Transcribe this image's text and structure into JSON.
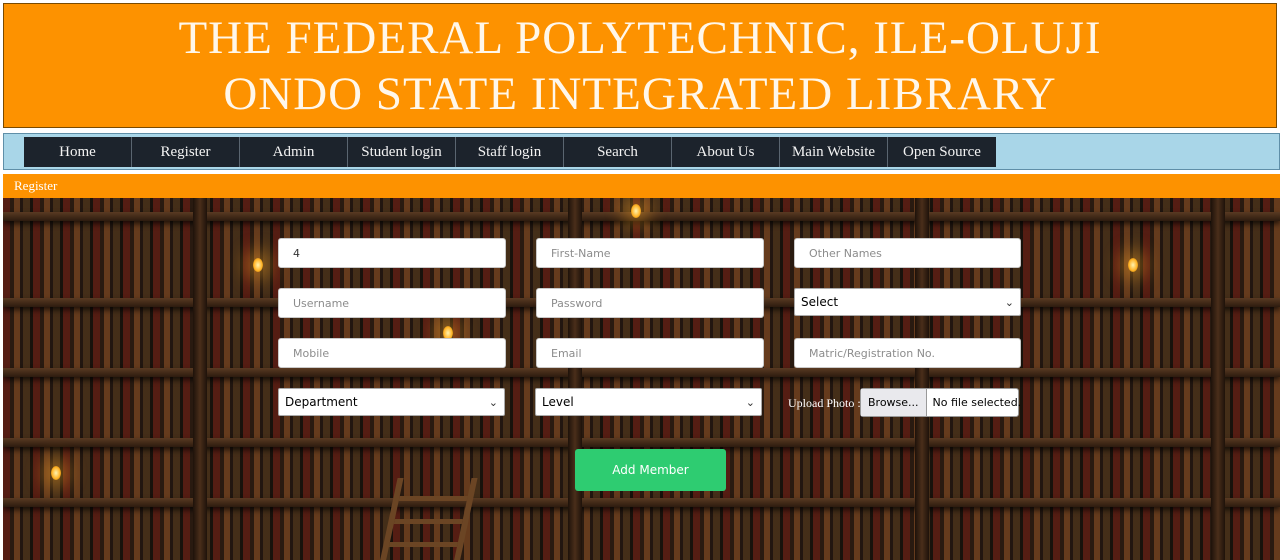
{
  "header": {
    "line1": "THE FEDERAL POLYTECHNIC, ILE-OLUJI",
    "line2": "ONDO STATE INTEGRATED LIBRARY"
  },
  "nav": {
    "items": [
      "Home",
      "Register",
      "Admin",
      "Student login",
      "Staff login",
      "Search",
      "About Us",
      "Main Website",
      "Open Source"
    ]
  },
  "breadcrumb": "Register",
  "form": {
    "title_value": "4",
    "first_name_placeholder": "First-Name",
    "other_names_placeholder": "Other Names",
    "username_placeholder": "Username",
    "password_placeholder": "Password",
    "select_value": "Select",
    "mobile_placeholder": "Mobile",
    "email_placeholder": "Email",
    "matric_placeholder": "Matric/Registration No.",
    "department_value": "Department",
    "level_value": "Level",
    "upload_label": "Upload Photo :",
    "browse_label": "Browse...",
    "no_file_label": "No file selected.",
    "submit_label": "Add Member"
  },
  "colors": {
    "banner": "#fd9200",
    "nav_bg": "#1c232c",
    "nav_strip": "#a9d6e8",
    "submit": "#2ecc71"
  }
}
